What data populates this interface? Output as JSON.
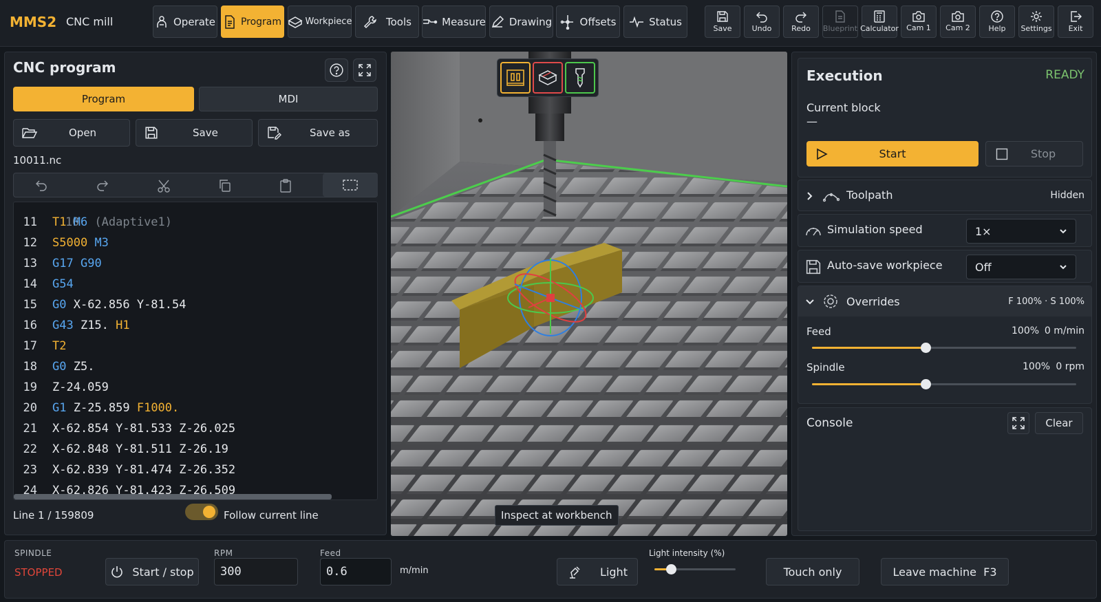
{
  "app": {
    "brand": "MMS2",
    "machine": "CNC mill"
  },
  "nav": [
    {
      "label": "Operate",
      "icon": "operator-icon"
    },
    {
      "label": "Program",
      "icon": "program-icon",
      "active": true
    },
    {
      "label": "Workpiece",
      "icon": "workpiece-icon"
    },
    {
      "label": "Tools",
      "icon": "wrench-icon"
    },
    {
      "label": "Measure",
      "icon": "probe-icon"
    },
    {
      "label": "Drawing",
      "icon": "pencil-icon"
    },
    {
      "label": "Offsets",
      "icon": "crosshair-icon"
    },
    {
      "label": "Status",
      "icon": "pulse-icon"
    }
  ],
  "toolbar": [
    {
      "label": "Save",
      "icon": "save-icon"
    },
    {
      "label": "Undo",
      "icon": "undo-icon"
    },
    {
      "label": "Redo",
      "icon": "redo-icon"
    },
    {
      "label": "Blueprint",
      "icon": "blueprint-icon",
      "disabled": true
    },
    {
      "label": "Calculator",
      "icon": "calculator-icon"
    },
    {
      "label": "Cam 1",
      "icon": "camera-icon"
    },
    {
      "label": "Cam 2",
      "icon": "camera-icon"
    },
    {
      "label": "Help",
      "icon": "help-icon"
    },
    {
      "label": "Settings",
      "icon": "gear-icon"
    },
    {
      "label": "Exit",
      "icon": "exit-icon"
    }
  ],
  "program_panel": {
    "title": "CNC program",
    "tabs": {
      "program": "Program",
      "mdi": "MDI"
    },
    "file_buttons": {
      "open": "Open",
      "save": "Save",
      "save_as": "Save as"
    },
    "filename": "10011.nc",
    "partial_top_line": {
      "num": "10",
      "text": "(Adaptive1)"
    },
    "lines": [
      {
        "num": "11",
        "tokens": [
          [
            "T1",
            "o"
          ],
          [
            " ",
            "plain"
          ],
          [
            "M6",
            "m"
          ]
        ]
      },
      {
        "num": "12",
        "tokens": [
          [
            "S5000",
            "o"
          ],
          [
            " ",
            "plain"
          ],
          [
            "M3",
            "m"
          ]
        ]
      },
      {
        "num": "13",
        "tokens": [
          [
            "G17",
            "g"
          ],
          [
            " ",
            "plain"
          ],
          [
            "G90",
            "g"
          ]
        ]
      },
      {
        "num": "14",
        "tokens": [
          [
            "G54",
            "g"
          ]
        ]
      },
      {
        "num": "15",
        "tokens": [
          [
            "G0",
            "g"
          ],
          [
            " X-62.856 Y-81.54",
            "plain"
          ]
        ]
      },
      {
        "num": "16",
        "tokens": [
          [
            "G43",
            "g"
          ],
          [
            " Z15. ",
            "plain"
          ],
          [
            "H1",
            "o"
          ]
        ]
      },
      {
        "num": "17",
        "tokens": [
          [
            "T2",
            "o"
          ]
        ]
      },
      {
        "num": "18",
        "tokens": [
          [
            "G0",
            "g"
          ],
          [
            " Z5.",
            "plain"
          ]
        ]
      },
      {
        "num": "19",
        "tokens": [
          [
            "Z-24.059",
            "plain"
          ]
        ]
      },
      {
        "num": "20",
        "tokens": [
          [
            "G1",
            "g"
          ],
          [
            " Z-25.859 ",
            "plain"
          ],
          [
            "F1000.",
            "o"
          ]
        ]
      },
      {
        "num": "21",
        "tokens": [
          [
            "X-62.854 Y-81.533 Z-26.025",
            "plain"
          ]
        ]
      },
      {
        "num": "22",
        "tokens": [
          [
            "X-62.848 Y-81.511 Z-26.19",
            "plain"
          ]
        ]
      },
      {
        "num": "23",
        "tokens": [
          [
            "X-62.839 Y-81.474 Z-26.352",
            "plain"
          ]
        ]
      },
      {
        "num": "24",
        "tokens": [
          [
            "X-62.826 Y-81.423 Z-26.509",
            "plain"
          ]
        ]
      }
    ],
    "line_status": "Line 1 / 159809",
    "follow_label": "Follow current line",
    "follow_enabled": true
  },
  "viewport": {
    "tooltip": "Inspect at workbench",
    "view_buttons": [
      "workbench-view-icon",
      "machine-view-icon",
      "tool-view-icon"
    ]
  },
  "execution": {
    "title": "Execution",
    "state": "READY",
    "current_block_label": "Current block",
    "current_block_value": "—",
    "start": "Start",
    "stop": "Stop"
  },
  "toolpath": {
    "label": "Toolpath",
    "value": "Hidden"
  },
  "sim_speed": {
    "label": "Simulation speed",
    "value": "1×"
  },
  "autosave": {
    "label": "Auto-save workpiece",
    "value": "Off"
  },
  "overrides": {
    "label": "Overrides",
    "summary": "F 100% · S 100%",
    "feed": {
      "label": "Feed",
      "percent": "100%",
      "value": "0 m/min",
      "level": 0.43
    },
    "spindle": {
      "label": "Spindle",
      "percent": "100%",
      "value": "0 rpm",
      "level": 0.43
    }
  },
  "console": {
    "label": "Console",
    "clear": "Clear"
  },
  "bottom": {
    "spindle_label": "SPINDLE",
    "spindle_state": "STOPPED",
    "start_stop": "Start / stop",
    "rpm_label": "RPM",
    "rpm_value": "300",
    "feed_label": "Feed",
    "feed_value": "0.6",
    "feed_unit": "m/min",
    "light": "Light",
    "light_intensity_label": "Light intensity (%)",
    "light_level": 0.2,
    "touch_only": "Touch only",
    "leave_machine": "Leave machine  F3"
  },
  "colors": {
    "accent": "#f3b233",
    "ready": "#7cc36e",
    "stopped": "#e0463a",
    "gcode": "#58a6f0"
  }
}
